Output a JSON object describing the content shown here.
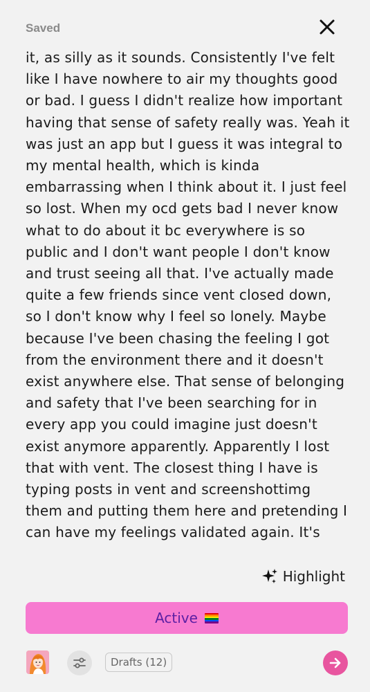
{
  "header": {
    "status": "Saved",
    "close_icon": "close-icon"
  },
  "post": {
    "body": "it, as silly as it sounds. Consistently I've felt like I have nowhere to air my thoughts good or bad. I guess I didn't realize how important having that sense of safety really was. Yeah it was just an app but I guess it was integral to my mental health, which is kinda embarrassing when I think about it. I just feel so lost. When my ocd gets bad I never know what to do about it bc everywhere is so public and I don't want people I don't know and trust seeing all that. I've actually made quite a few friends since vent closed down, so I don't know why I feel so lonely. Maybe because I've been chasing the feeling I got from the environment there and it doesn't exist anywhere else. That sense of belonging and safety that I've been searching for in every app you could imagine just doesn't exist anymore apparently. Apparently I lost that with vent. The closest thing I have is typing posts in vent and screenshottimg them and putting them here and pretending I can have my feelings validated again. It's"
  },
  "toolbar": {
    "highlight_label": "Highlight",
    "highlight_icon": "sparkle-icon",
    "active_label": "Active",
    "active_emoji": "pride-flag",
    "drafts_label": "Drafts (12)",
    "filter_icon": "sliders-icon",
    "next_icon": "arrow-right-icon",
    "avatar_icon": "avatar"
  },
  "colors": {
    "background": "#f2f2f2",
    "active_bar": "#f77ad0",
    "active_text": "#5b1fa3",
    "next_button": "#e8559f",
    "saved_text": "#8a8a8a"
  }
}
